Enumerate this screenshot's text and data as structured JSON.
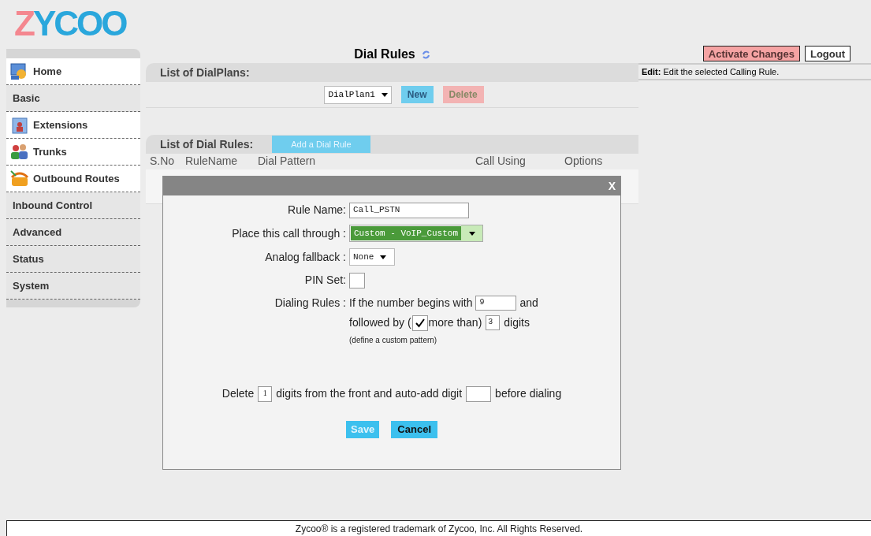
{
  "logo": "ZYCOO",
  "sidebar": {
    "items": [
      {
        "label": "Home",
        "kind": "icon"
      },
      {
        "label": "Basic",
        "kind": "plain"
      },
      {
        "label": "Extensions",
        "kind": "icon"
      },
      {
        "label": "Trunks",
        "kind": "icon"
      },
      {
        "label": "Outbound Routes",
        "kind": "icon"
      },
      {
        "label": "Inbound Control",
        "kind": "plain"
      },
      {
        "label": "Advanced",
        "kind": "plain"
      },
      {
        "label": "Status",
        "kind": "plain"
      },
      {
        "label": "System",
        "kind": "plain"
      }
    ]
  },
  "page_title": "Dial Rules",
  "dialplans": {
    "title": "List of DialPlans:",
    "select": "DialPlan1",
    "new_button": "New",
    "delete_button": "Delete"
  },
  "dial_rules": {
    "title": "List of Dial Rules:",
    "add_button": "Add a Dial Rule",
    "columns": [
      "S.No",
      "RuleName",
      "Dial Pattern",
      "Call Using",
      "Options"
    ]
  },
  "top_buttons": [
    "Activate Changes",
    "Logout"
  ],
  "help": {
    "label": "Edit:",
    "text": "Edit the selected Calling Rule."
  },
  "dialog": {
    "close": "X",
    "rule_name_label": "Rule Name:",
    "rule_name": "Call_PSTN",
    "through_label": "Place this call through :",
    "through_value": "Custom - VoIP_Custom",
    "fallback_label": "Analog fallback :",
    "fallback_value": "None",
    "pin_label": "PIN Set:",
    "pin_checked": false,
    "dialing_label": "Dialing Rules :",
    "begins_text": "If the number begins with",
    "begins_value": "9",
    "and_text": "and",
    "followed_text": "followed by (",
    "more_checked": true,
    "more_text": "more than)",
    "digits_value": "3",
    "digits_text": "digits",
    "hint": "(define a custom pattern)",
    "delete_text": "Delete",
    "delete_value": "1",
    "front_text": "digits from the front and auto-add digit",
    "before_text": "before dialing",
    "save_button": "Save",
    "cancel_button": "Cancel"
  },
  "footer": "Zycoo® is a registered trademark of Zycoo, Inc. All Rights Reserved."
}
